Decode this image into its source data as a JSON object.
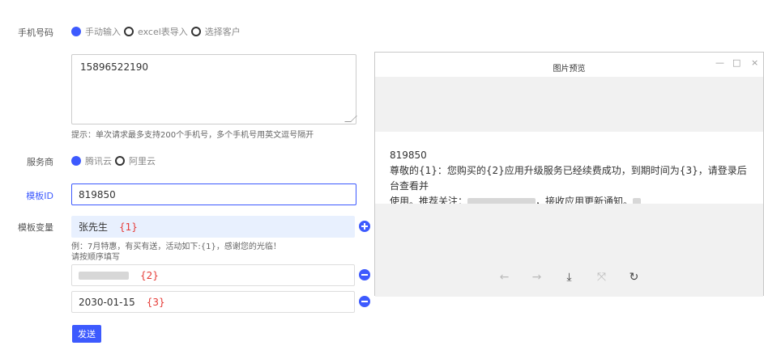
{
  "form": {
    "phone_label": "手机号码",
    "phone_modes": [
      {
        "label": "手动输入",
        "checked": true
      },
      {
        "label": "excel表导入",
        "checked": false
      },
      {
        "label": "选择客户",
        "checked": false
      }
    ],
    "phone_value": "15896522190",
    "phone_hint": "提示：单次请求最多支持200个手机号，多个手机号用英文逗号隔开",
    "provider_label": "服务商",
    "providers": [
      {
        "label": "腾讯云",
        "checked": true
      },
      {
        "label": "阿里云",
        "checked": false
      }
    ],
    "template_id_label": "模板ID",
    "template_id_value": "819850",
    "template_var_label": "模板变量",
    "variables": [
      {
        "value": "张先生",
        "tag": "{1}"
      },
      {
        "value": "",
        "tag": "{2}"
      },
      {
        "value": "2030-01-15",
        "tag": "{3}"
      }
    ],
    "var_hint_1": "例：7月特惠，有买有送，活动如下:{1}，感谢您的光临！",
    "var_hint_2": "请按顺序填写",
    "send_label": "发送"
  },
  "preview": {
    "title": "图片预览",
    "controls": {
      "minimize": "—",
      "maximize": "□",
      "close": "×"
    },
    "line1": "819850",
    "line2": "尊敬的{1}：您购买的{2}应用升级服务已经续费成功，到期时间为{3}，请登录后台查看并",
    "line3_start": "使用。推荐关注：",
    "line3_end": "，接收应用更新通知。",
    "toolbar": {
      "prev": "←",
      "next": "→",
      "download": "⤓",
      "fit": "⤧",
      "rotate": "↻"
    }
  }
}
